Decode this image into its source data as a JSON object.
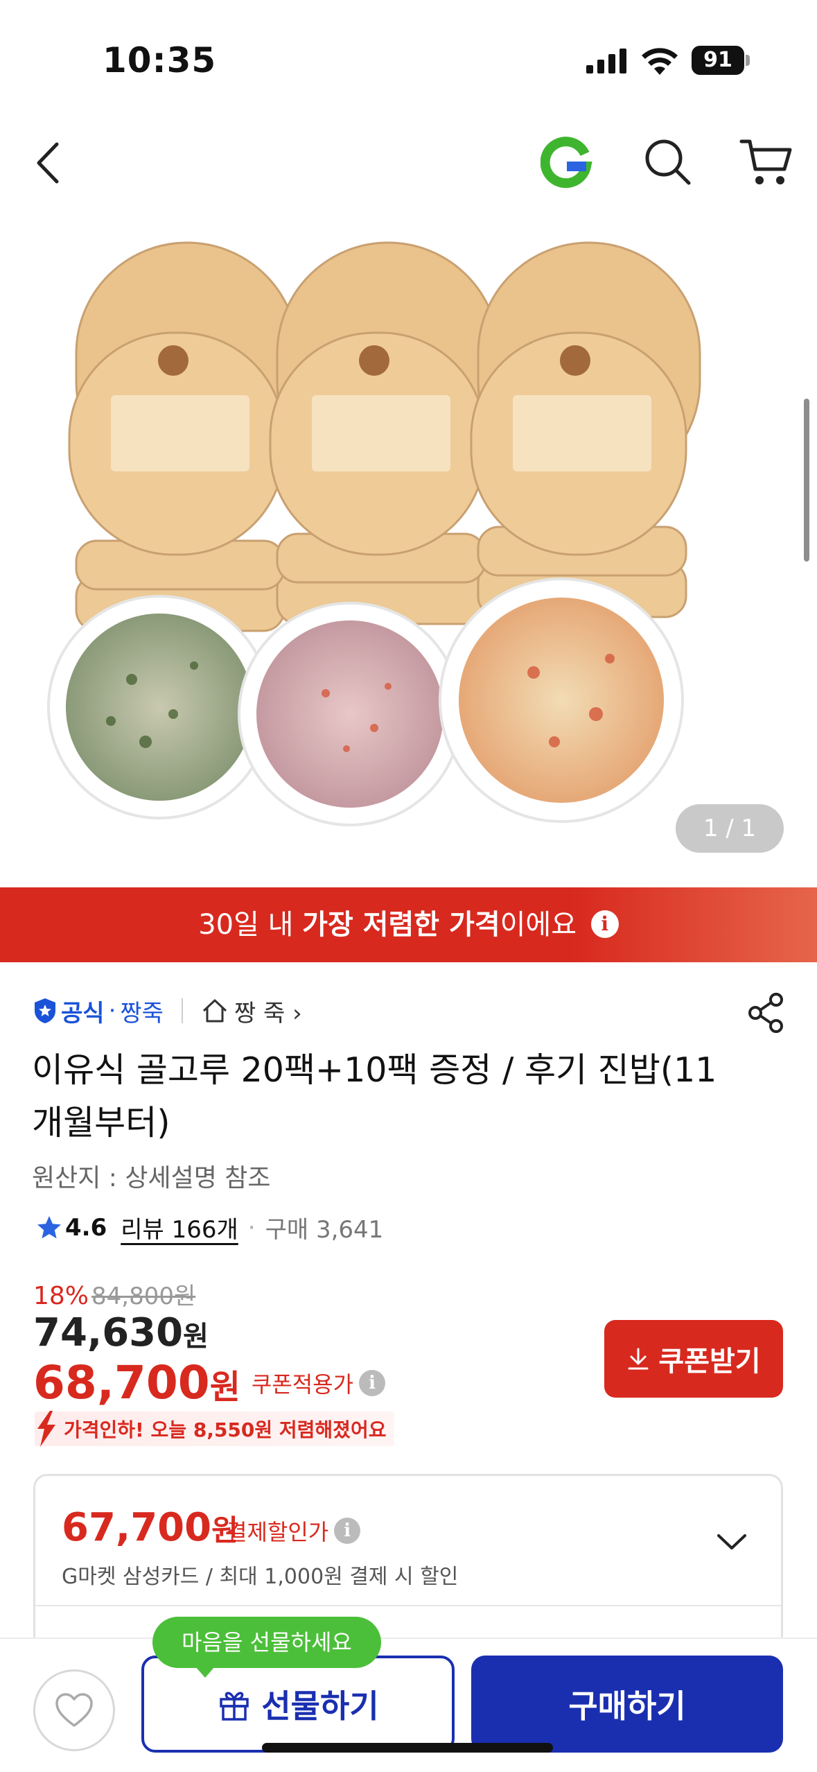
{
  "status_bar": {
    "time": "10:35",
    "battery": "91"
  },
  "product_image": {
    "counter": "1 / 1"
  },
  "banner": {
    "prefix": "30일 내 ",
    "bold": "가장 저렴한 가격",
    "suffix": "이에요"
  },
  "brand": {
    "official": "공식",
    "name": "짱죽",
    "store": "짱 죽 ›"
  },
  "product": {
    "title": "이유식 골고루 20팩+10팩 증정 / 후기 진밥(11개월부터)",
    "origin": "원산지 : 상세설명 참조",
    "rating": "4.6",
    "reviews": "리뷰 166개",
    "purchases": "구매 3,641"
  },
  "pricing": {
    "discount_pct": "18%",
    "original_price": "84,800원",
    "sale_price": "74,630",
    "sale_unit": "원",
    "coupon_price": "68,700",
    "coupon_unit": "원",
    "coupon_label": "쿠폰적용가",
    "coupon_button": "쿠폰받기",
    "price_drop_text": "가격인하! 오늘 8,550원 저렴해졌어요"
  },
  "card_discount": {
    "price": "67,700",
    "unit": "원",
    "label": "결제할인가",
    "description": "G마켓 삼성카드 / 최대 1,000원 결제 시 할인"
  },
  "bottom_bar": {
    "tooltip": "마음을 선물하세요",
    "gift_label": "선물하기",
    "buy_label": "구매하기"
  },
  "colors": {
    "accent_red": "#d8291f",
    "brand_blue": "#1a2fb0",
    "tooltip_green": "#4cbf3a"
  }
}
